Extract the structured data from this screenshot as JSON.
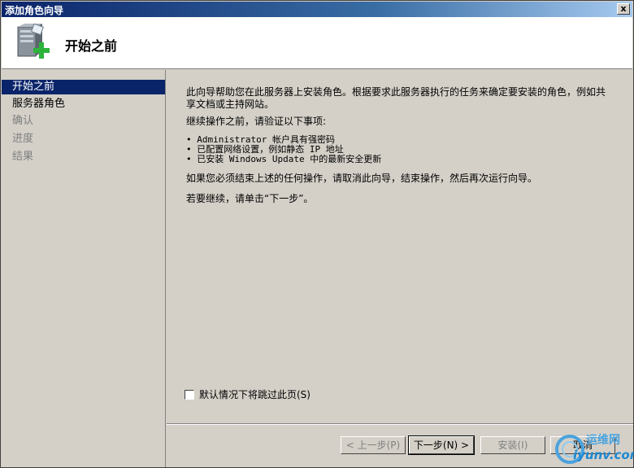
{
  "window": {
    "title": "添加角色向导",
    "close_glyph": "x"
  },
  "header": {
    "title": "开始之前",
    "icon": "server-add-icon"
  },
  "nav": {
    "items": [
      {
        "label": "开始之前",
        "state": "active"
      },
      {
        "label": "服务器角色",
        "state": "enabled"
      },
      {
        "label": "确认",
        "state": "disabled"
      },
      {
        "label": "进度",
        "state": "disabled"
      },
      {
        "label": "结果",
        "state": "disabled"
      }
    ]
  },
  "content": {
    "intro": "此向导帮助您在此服务器上安装角色。根据要求此服务器执行的任务来确定要安装的角色，例如共享文档或主持网站。",
    "verify_heading": "继续操作之前，请验证以下事项:",
    "bullets": [
      "Administrator 帐户具有强密码",
      "已配置网络设置，例如静态 IP 地址",
      "已安装 Windows Update 中的最新安全更新"
    ],
    "cancel_note": "如果您必须结束上述的任何操作，请取消此向导，结束操作，然后再次运行向导。",
    "continue_note": "若要继续，请单击“下一步”。",
    "skip_checkbox": {
      "label": "默认情况下将跳过此页(S)",
      "checked": false
    }
  },
  "buttons": {
    "prev": "< 上一步(P)",
    "next": "下一步(N) >",
    "install": "安装(I)",
    "cancel": "取消"
  },
  "watermark": {
    "line1": "运维网",
    "line2": "iyunv.com"
  }
}
